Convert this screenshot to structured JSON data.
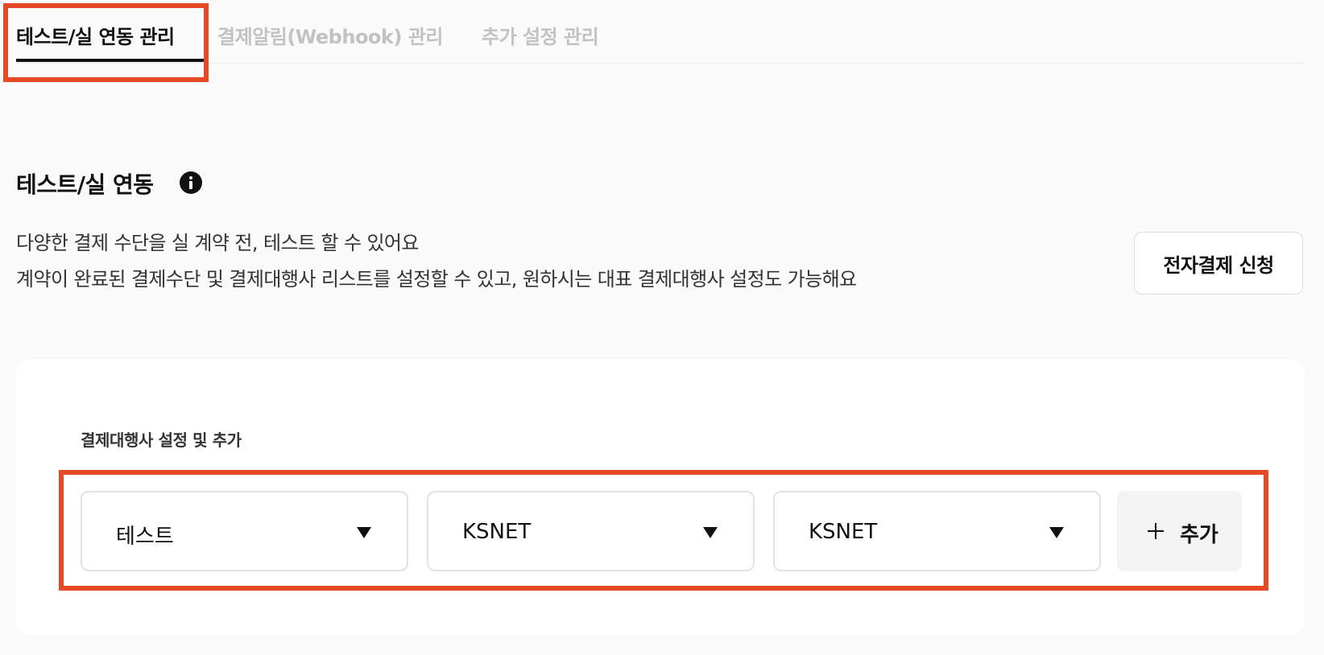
{
  "tabs": [
    {
      "label": "테스트/실 연동 관리",
      "active": true
    },
    {
      "label": "결제알림(Webhook) 관리",
      "active": false
    },
    {
      "label": "추가 설정 관리",
      "active": false
    }
  ],
  "section": {
    "title": "테스트/실 연동",
    "info_icon": "info-icon",
    "description_lines": [
      "다양한 결제 수단을 실 계약 전, 테스트 할 수 있어요",
      "계약이 완료된 결제수단 및 결제대행사 리스트를 설정할 수 있고, 원하시는 대표 결제대행사 설정도 가능해요"
    ],
    "apply_button": "전자결제 신청"
  },
  "card": {
    "label": "결제대행사 설정 및 추가",
    "selects": [
      {
        "value": "테스트",
        "icon": "caret-down-icon"
      },
      {
        "value": "KSNET",
        "icon": "caret-down-icon"
      },
      {
        "value": "KSNET",
        "icon": "caret-down-icon"
      }
    ],
    "add_button": {
      "label": "추가",
      "icon": "plus-icon"
    }
  },
  "colors": {
    "highlight": "#e64a24",
    "background": "#fafafa",
    "text": "#111111",
    "inactive_tab": "#c2c2c2"
  }
}
